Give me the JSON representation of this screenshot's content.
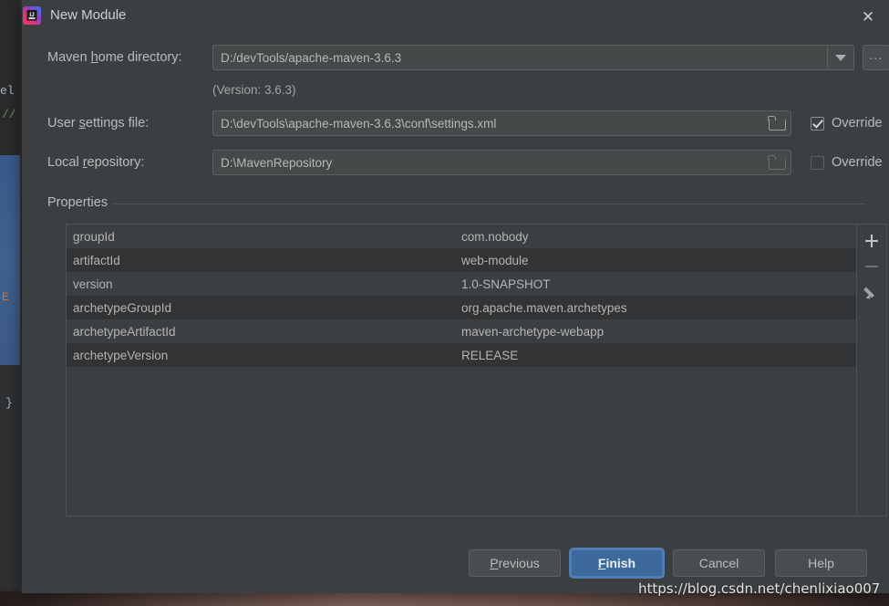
{
  "window": {
    "title": "New Module",
    "app_icon": "intellij-idea-icon",
    "close_icon": "close-icon"
  },
  "form": {
    "maven_home": {
      "label_before": "Maven ",
      "label_mnemonic": "h",
      "label_after": "ome directory:",
      "value": "D:/devTools/apache-maven-3.6.3",
      "dropdown_icon": "chevron-down-icon",
      "browse_label": "...",
      "version_note": "(Version: 3.6.3)"
    },
    "user_settings": {
      "label_before": "User ",
      "label_mnemonic": "s",
      "label_after": "ettings file:",
      "value": "D:\\devTools\\apache-maven-3.6.3\\conf\\settings.xml",
      "folder_icon": "folder-icon",
      "override_label": "Override",
      "override_checked": true
    },
    "local_repository": {
      "label_before": "Local ",
      "label_mnemonic": "r",
      "label_after": "epository:",
      "value": "D:\\MavenRepository",
      "folder_icon": "folder-icon",
      "override_label": "Override",
      "override_checked": false
    }
  },
  "properties": {
    "group_title": "Properties",
    "rows": [
      {
        "key": "groupId",
        "value": "com.nobody"
      },
      {
        "key": "artifactId",
        "value": "web-module"
      },
      {
        "key": "version",
        "value": "1.0-SNAPSHOT"
      },
      {
        "key": "archetypeGroupId",
        "value": "org.apache.maven.archetypes"
      },
      {
        "key": "archetypeArtifactId",
        "value": "maven-archetype-webapp"
      },
      {
        "key": "archetypeVersion",
        "value": "RELEASE"
      }
    ],
    "toolbar": {
      "add_icon": "plus-icon",
      "remove_icon": "minus-icon",
      "edit_icon": "pencil-icon"
    }
  },
  "buttons": {
    "previous": {
      "before": "",
      "mnemonic": "P",
      "after": "revious"
    },
    "finish": {
      "before": "",
      "mnemonic": "F",
      "after": "inish"
    },
    "cancel": {
      "label": "Cancel"
    },
    "help": {
      "label": "Help"
    }
  },
  "watermark": "https://blog.csdn.net/chenlixiao007",
  "background_code": {
    "line1": "//",
    "line2": "el",
    "line3": "E",
    "line4": "}"
  },
  "colors": {
    "dialog_bg": "#3c3f41",
    "field_bg": "#45494a",
    "row_alt": "#313335",
    "primary_button": "#3d699b",
    "text": "#bbbbbb"
  }
}
